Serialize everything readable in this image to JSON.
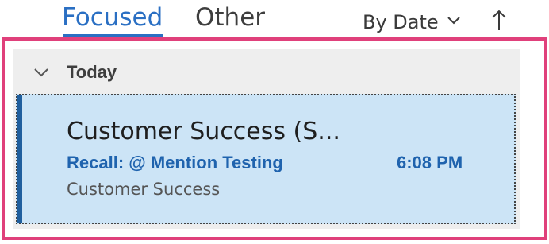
{
  "header": {
    "tabs": [
      {
        "label": "Focused",
        "active": true
      },
      {
        "label": "Other",
        "active": false
      }
    ],
    "sort_label": "By Date",
    "sort_chevron_icon": "chevron-down-icon",
    "sort_direction_icon": "arrow-up-icon"
  },
  "list": {
    "group": {
      "label": "Today",
      "icon": "chevron-down-icon"
    },
    "messages": [
      {
        "sender": "Customer Success (S...",
        "subject": "Recall: @ Mention Testing",
        "time": "6:08 PM",
        "preview": "Customer Success",
        "selected": true
      }
    ]
  },
  "colors": {
    "accent": "#2a6fc3",
    "highlight_frame": "#e0407b",
    "selected_bg": "#cce4f6",
    "selected_bar": "#205f9e",
    "subject_text": "#1f63ae",
    "group_bg": "#eeeeee"
  }
}
